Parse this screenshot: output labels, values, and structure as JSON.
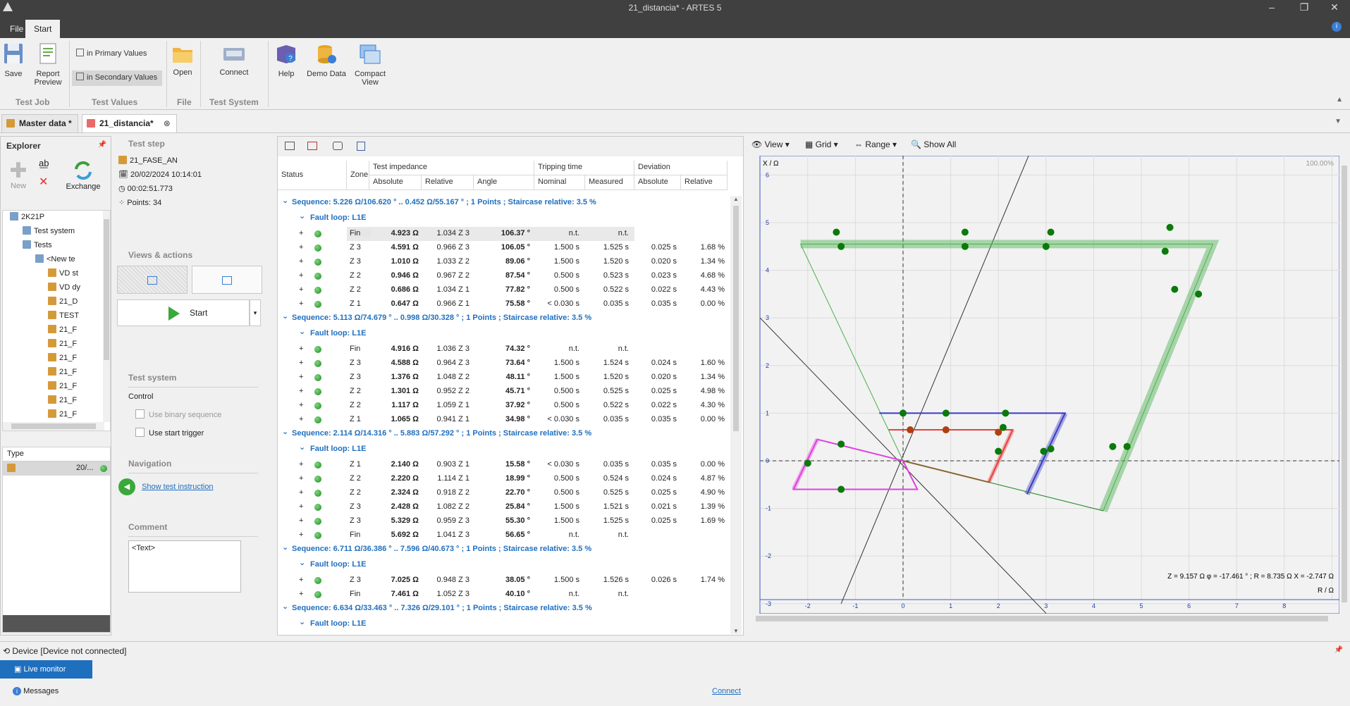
{
  "window": {
    "title": "21_distancia* - ARTES 5",
    "minimize": "–",
    "restore": "❐",
    "close": "✕"
  },
  "ribbon_tabs": [
    "File",
    "Start"
  ],
  "ribbon": {
    "save": "Save",
    "report_preview_1": "Report",
    "report_preview_2": "Preview",
    "primary_values": "in Primary Values",
    "secondary_values": "in Secondary Values",
    "open": "Open",
    "connect": "Connect",
    "help": "Help",
    "demo_data": "Demo Data",
    "compact_view_1": "Compact",
    "compact_view_2": "View",
    "groups": {
      "test_job": "Test Job",
      "test_values": "Test Values",
      "file": "File",
      "test_system": "Test System"
    }
  },
  "doc_tabs": {
    "master": "Master data *",
    "distancia": "21_distancia*"
  },
  "explorer": {
    "title": "Explorer",
    "new": "New",
    "exchange": "Exchange",
    "tree": [
      {
        "label": "2K21P",
        "indent": 0
      },
      {
        "label": "Test system",
        "indent": 1
      },
      {
        "label": "Tests",
        "indent": 1
      },
      {
        "label": "<New te",
        "indent": 2
      },
      {
        "label": "VD st",
        "indent": 3
      },
      {
        "label": "VD dy",
        "indent": 3
      },
      {
        "label": "21_D",
        "indent": 3
      },
      {
        "label": "TEST",
        "indent": 3
      },
      {
        "label": "21_F",
        "indent": 3
      },
      {
        "label": "21_F",
        "indent": 3
      },
      {
        "label": "21_F",
        "indent": 3
      },
      {
        "label": "21_F",
        "indent": 3
      },
      {
        "label": "21_F",
        "indent": 3
      },
      {
        "label": "21_F",
        "indent": 3
      },
      {
        "label": "21_F",
        "indent": 3
      }
    ],
    "type_header": "Type",
    "type_row": "20/..."
  },
  "teststep": {
    "title": "Test step",
    "name": "21_FASE_AN",
    "datetime": "20/02/2024 10:14:01",
    "duration": "00:02:51.773",
    "points": "Points: 34",
    "views_actions": "Views & actions",
    "start": "Start",
    "test_system": "Test system",
    "control": "Control",
    "use_binary": "Use binary sequence",
    "use_trigger": "Use start trigger",
    "navigation": "Navigation",
    "show_instruction": "Show test instruction",
    "comment": "Comment",
    "comment_text": "<Text>"
  },
  "table": {
    "headers": {
      "status": "Status",
      "zone": "Zone",
      "test_impedance": "Test impedance",
      "tripping_time": "Tripping time",
      "deviation": "Deviation",
      "absolute": "Absolute",
      "relative": "Relative",
      "angle": "Angle",
      "nominal": "Nominal",
      "measured": "Measured",
      "dev_abs": "Absolute",
      "dev_rel": "Relative"
    },
    "sequences": [
      {
        "title": "Sequence: 5.226 Ω/106.620 ° .. 0.452 Ω/55.167 ° ; 1 Points ; Staircase relative: 3.5 %",
        "loop": "Fault loop: L1E",
        "rows": [
          [
            "Fin",
            "4.923 Ω",
            "1.034 Z 3",
            "106.37 °",
            "n.t.",
            "n.t.",
            "",
            ""
          ],
          [
            "Z 3",
            "4.591 Ω",
            "0.966 Z 3",
            "106.05 °",
            "1.500 s",
            "1.525 s",
            "0.025 s",
            "1.68 %"
          ],
          [
            "Z 3",
            "1.010 Ω",
            "1.033 Z 2",
            "89.06 °",
            "1.500 s",
            "1.520 s",
            "0.020 s",
            "1.34 %"
          ],
          [
            "Z 2",
            "0.946 Ω",
            "0.967 Z 2",
            "87.54 °",
            "0.500 s",
            "0.523 s",
            "0.023 s",
            "4.68 %"
          ],
          [
            "Z 2",
            "0.686 Ω",
            "1.034 Z 1",
            "77.82 °",
            "0.500 s",
            "0.522 s",
            "0.022 s",
            "4.43 %"
          ],
          [
            "Z 1",
            "0.647 Ω",
            "0.966 Z 1",
            "75.58 °",
            "< 0.030 s",
            "0.035 s",
            "0.035 s",
            "0.00 %"
          ]
        ]
      },
      {
        "title": "Sequence: 5.113 Ω/74.679 ° .. 0.998 Ω/30.328 ° ; 1 Points ; Staircase relative: 3.5 %",
        "loop": "Fault loop: L1E",
        "rows": [
          [
            "Fin",
            "4.916 Ω",
            "1.036 Z 3",
            "74.32 °",
            "n.t.",
            "n.t.",
            "",
            ""
          ],
          [
            "Z 3",
            "4.588 Ω",
            "0.964 Z 3",
            "73.64 °",
            "1.500 s",
            "1.524 s",
            "0.024 s",
            "1.60 %"
          ],
          [
            "Z 3",
            "1.376 Ω",
            "1.048 Z 2",
            "48.11 °",
            "1.500 s",
            "1.520 s",
            "0.020 s",
            "1.34 %"
          ],
          [
            "Z 2",
            "1.301 Ω",
            "0.952 Z 2",
            "45.71 °",
            "0.500 s",
            "0.525 s",
            "0.025 s",
            "4.98 %"
          ],
          [
            "Z 2",
            "1.117 Ω",
            "1.059 Z 1",
            "37.92 °",
            "0.500 s",
            "0.522 s",
            "0.022 s",
            "4.30 %"
          ],
          [
            "Z 1",
            "1.065 Ω",
            "0.941 Z 1",
            "34.98 °",
            "< 0.030 s",
            "0.035 s",
            "0.035 s",
            "0.00 %"
          ]
        ]
      },
      {
        "title": "Sequence: 2.114 Ω/14.316 ° .. 5.883 Ω/57.292 ° ; 1 Points ; Staircase relative: 3.5 %",
        "loop": "Fault loop: L1E",
        "rows": [
          [
            "Z 1",
            "2.140 Ω",
            "0.903 Z 1",
            "15.58 °",
            "< 0.030 s",
            "0.035 s",
            "0.035 s",
            "0.00 %"
          ],
          [
            "Z 2",
            "2.220 Ω",
            "1.114 Z 1",
            "18.99 °",
            "0.500 s",
            "0.524 s",
            "0.024 s",
            "4.87 %"
          ],
          [
            "Z 2",
            "2.324 Ω",
            "0.918 Z 2",
            "22.70 °",
            "0.500 s",
            "0.525 s",
            "0.025 s",
            "4.90 %"
          ],
          [
            "Z 3",
            "2.428 Ω",
            "1.082 Z 2",
            "25.84 °",
            "1.500 s",
            "1.521 s",
            "0.021 s",
            "1.39 %"
          ],
          [
            "Z 3",
            "5.329 Ω",
            "0.959 Z 3",
            "55.30 °",
            "1.500 s",
            "1.525 s",
            "0.025 s",
            "1.69 %"
          ],
          [
            "Fin",
            "5.692 Ω",
            "1.041 Z 3",
            "56.65 °",
            "n.t.",
            "n.t.",
            "",
            ""
          ]
        ]
      },
      {
        "title": "Sequence: 6.711 Ω/36.386 ° .. 7.596 Ω/40.673 ° ; 1 Points ; Staircase relative: 3.5 %",
        "loop": "Fault loop: L1E",
        "rows": [
          [
            "Z 3",
            "7.025 Ω",
            "0.948 Z 3",
            "38.05 °",
            "1.500 s",
            "1.526 s",
            "0.026 s",
            "1.74 %"
          ],
          [
            "Fin",
            "7.461 Ω",
            "1.052 Z 3",
            "40.10 °",
            "n.t.",
            "n.t.",
            "",
            ""
          ]
        ]
      },
      {
        "title": "Sequence: 6.634 Ω/33.463 ° .. 7.326 Ω/29.101 ° ; 1 Points ; Staircase relative: 3.5 %",
        "loop": "Fault loop: L1E",
        "rows": []
      }
    ]
  },
  "plot": {
    "view": "View",
    "grid": "Grid",
    "range": "Range",
    "show_all": "Show All",
    "zoom": "100.00%",
    "ylabel": "X / Ω",
    "xlabel": "R / Ω",
    "readout": "Z = 9.157 Ω   φ = -17.461 ° ; R = 8.735 Ω   X = -2.747 Ω",
    "xticks": [
      "-2",
      "-1",
      "0",
      "1",
      "2",
      "3",
      "4",
      "5",
      "6",
      "7",
      "8"
    ],
    "yticks": [
      "6",
      "5",
      "4",
      "3",
      "2",
      "1",
      "0",
      "-1",
      "-2",
      "-3"
    ],
    "colors": {
      "zone3": "#4caf50",
      "zone2": "#3a3ac8",
      "zone1": "#e84040",
      "zone_rev": "#e040e0",
      "trip": "#0a7a0a",
      "nontrip": "#b04010"
    },
    "points_green": [
      [
        -2.0,
        -0.05
      ],
      [
        -1.3,
        -0.6
      ],
      [
        -1.3,
        0.35
      ],
      [
        0.0,
        1.0
      ],
      [
        0.9,
        1.0
      ],
      [
        2.15,
        1.0
      ],
      [
        2.1,
        0.7
      ],
      [
        2.0,
        0.2
      ],
      [
        2.95,
        0.2
      ],
      [
        3.1,
        0.25
      ],
      [
        4.4,
        0.3
      ],
      [
        4.7,
        0.3
      ],
      [
        -1.4,
        4.8
      ],
      [
        -1.3,
        4.5
      ],
      [
        1.3,
        4.8
      ],
      [
        1.3,
        4.5
      ],
      [
        3.1,
        4.8
      ],
      [
        3.0,
        4.5
      ],
      [
        5.6,
        4.9
      ],
      [
        5.5,
        4.4
      ],
      [
        5.7,
        3.6
      ],
      [
        6.2,
        3.5
      ]
    ],
    "points_nontrip": [
      [
        0.15,
        0.65
      ],
      [
        0.9,
        0.65
      ],
      [
        2.0,
        0.6
      ]
    ]
  },
  "bottom": {
    "device": "Device [Device not connected]",
    "live_monitor": "Live monitor",
    "messages": "Messages",
    "connect": "Connect"
  }
}
